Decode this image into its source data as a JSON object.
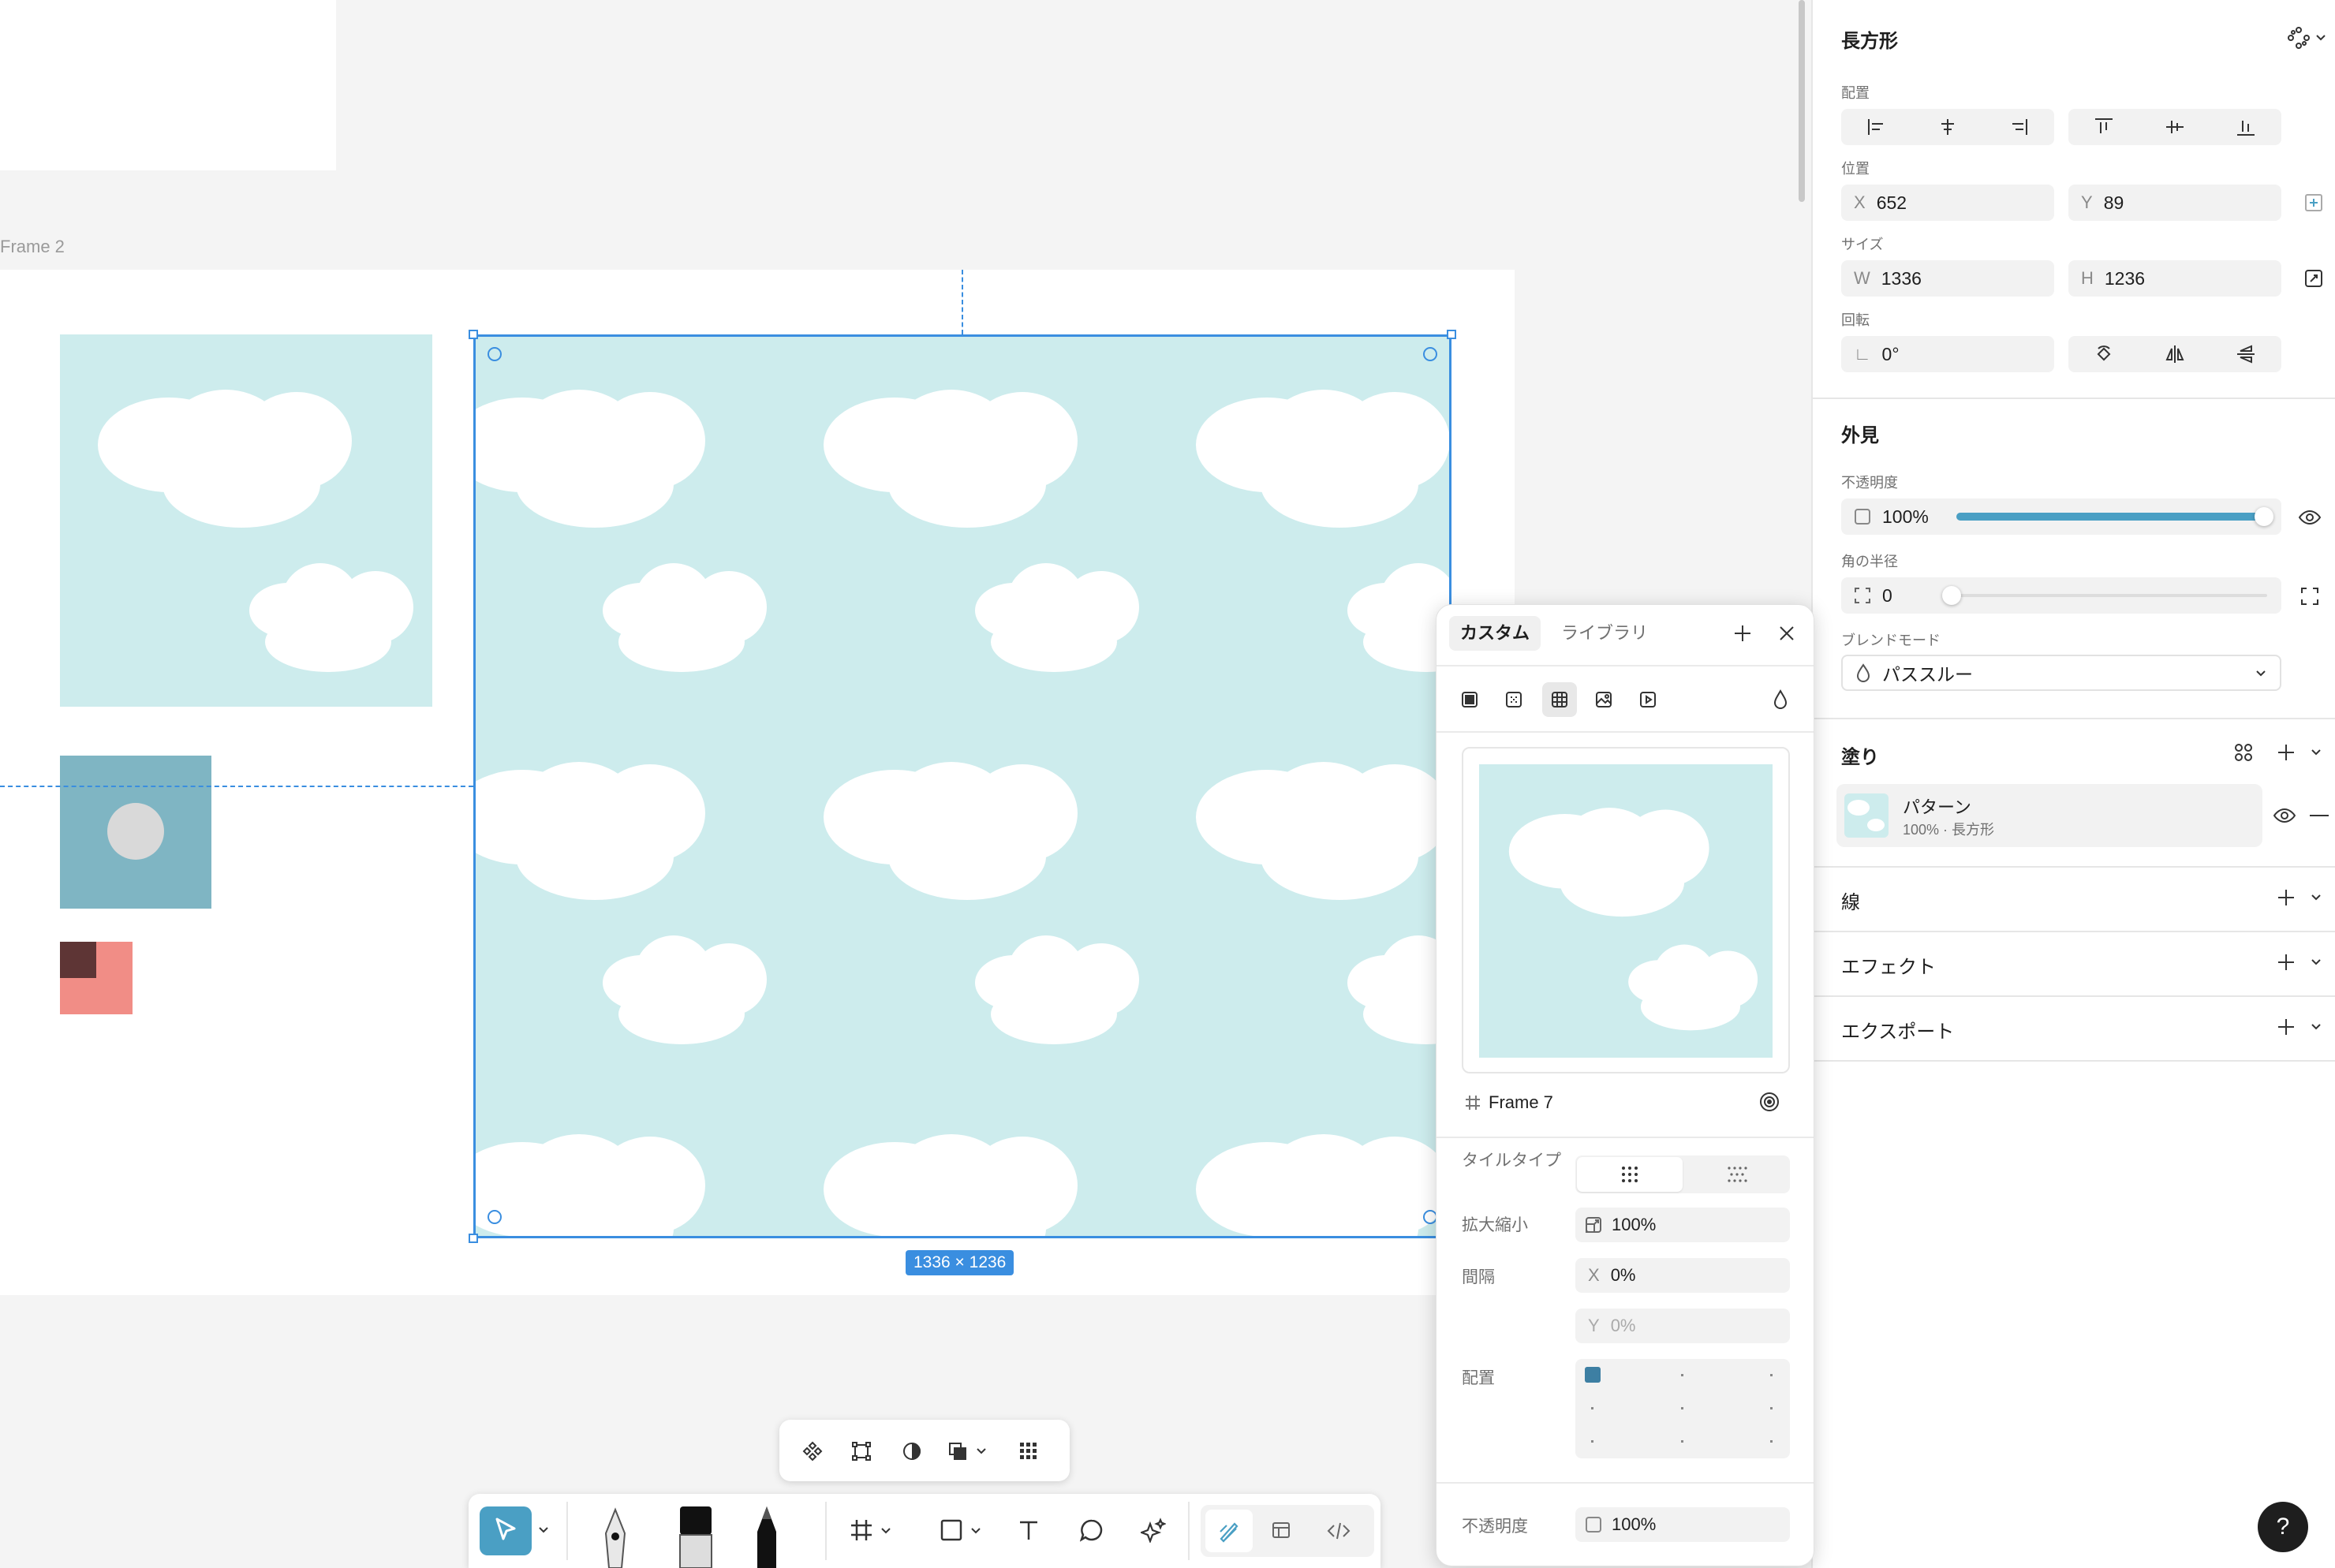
{
  "canvas": {
    "frame_label": "Frame 2",
    "selection_size": "1336 × 1236"
  },
  "panel": {
    "title": "長方形",
    "align_label": "配置",
    "position_label": "位置",
    "x_prefix": "X",
    "x_value": "652",
    "y_prefix": "Y",
    "y_value": "89",
    "size_label": "サイズ",
    "w_prefix": "W",
    "w_value": "1336",
    "h_prefix": "H",
    "h_value": "1236",
    "rotation_label": "回転",
    "rotation_value": "0°",
    "appearance_title": "外見",
    "opacity_label": "不透明度",
    "opacity_value": "100%",
    "opacity_level": 1.0,
    "radius_label": "角の半径",
    "radius_value": "0",
    "blend_label": "ブレンドモード",
    "blend_value": "パススルー",
    "fill_title": "塗り",
    "fill_name": "パターン",
    "fill_sub": "100% · 長方形",
    "stroke_title": "線",
    "effects_title": "エフェクト",
    "export_title": "エクスポート",
    "help": "?"
  },
  "popup": {
    "tab_custom": "カスタム",
    "tab_library": "ライブラリ",
    "source_name": "Frame 7",
    "tile_type_label": "タイルタイプ",
    "scale_label": "拡大縮小",
    "scale_value": "100%",
    "spacing_label": "間隔",
    "spacing_x_prefix": "X",
    "spacing_x_value": "0%",
    "spacing_y_prefix": "Y",
    "spacing_y_value": "0%",
    "alignment_label": "配置",
    "opacity_label": "不透明度",
    "opacity_value": "100%"
  },
  "colors": {
    "accent": "#3a8ee0",
    "sky": "#cdeced",
    "teal_square": "#7fb5c3",
    "slider": "#4a9fc4"
  }
}
